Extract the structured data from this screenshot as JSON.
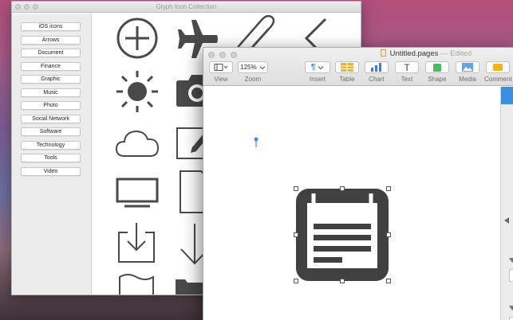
{
  "glyph_window": {
    "title": "Glyph Icon Collection",
    "categories": [
      "iOS icons",
      "Arrows",
      "Document",
      "Finance",
      "Graphic",
      "Music",
      "Photo",
      "Social Network",
      "Software",
      "Technology",
      "Tools",
      "Video"
    ],
    "icons": [
      "plus-circle-icon",
      "airplane-icon",
      "paperclip-icon",
      "chevron-left-icon",
      "sun-icon",
      "camera-icon",
      "cloud-icon",
      "edit-square-icon",
      "monitor-icon",
      "blank-document-icon",
      "download-tray-icon",
      "down-arrow-icon",
      "flag-icon",
      "folder-icon"
    ]
  },
  "pages_window": {
    "doc_name": "Untitled.pages",
    "separator": "—",
    "status": "Edited",
    "toolbar": {
      "view_label": "View",
      "zoom_value": "125%",
      "zoom_label": "Zoom",
      "insert_label": "Insert",
      "table_label": "Table",
      "chart_label": "Chart",
      "text_label": "Text",
      "shape_label": "Shape",
      "media_label": "Media",
      "comment_label": "Comment"
    },
    "inserted_icon": "notepad-icon"
  },
  "colors": {
    "accent": "#3b8fe0",
    "glyph": "#4a4a4a",
    "table": "#f1b51d",
    "chart": "#3b7fd9",
    "shape": "#4cbb5a",
    "media": "#5ba7e5",
    "comment": "#f2b31b"
  }
}
